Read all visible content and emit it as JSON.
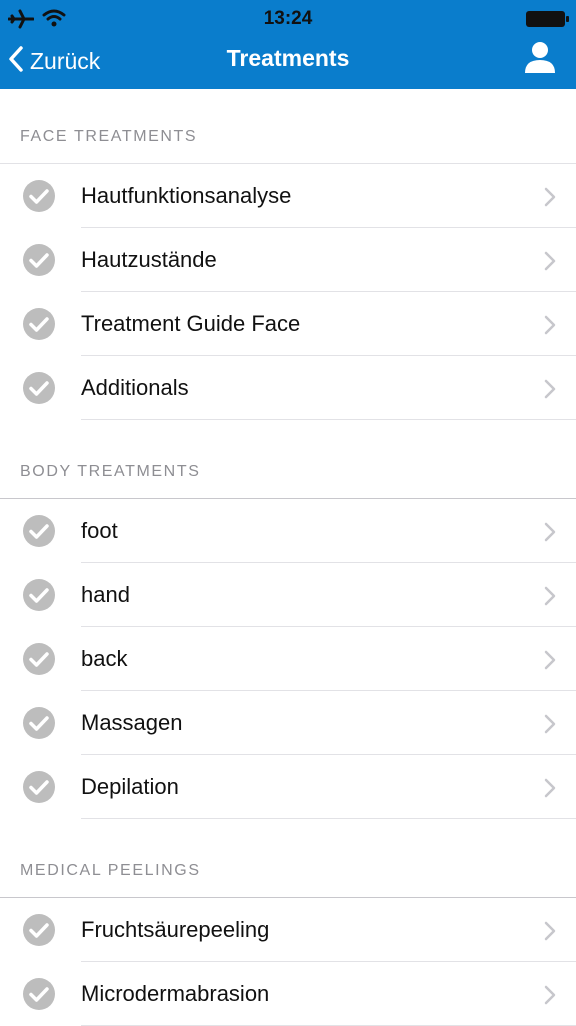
{
  "status_bar": {
    "time": "13:24"
  },
  "nav": {
    "back_label": "Zurück",
    "title": "Treatments"
  },
  "colors": {
    "header_background": "#0a7dcc",
    "check_icon": "#bdbdbd",
    "chevron": "#c7c7cc",
    "section_header_text": "#8e8e93"
  },
  "icons": {
    "status": [
      "airplane-icon",
      "wifi-icon",
      "battery-icon"
    ],
    "nav": [
      "chevron-left-icon",
      "user-icon"
    ],
    "row": [
      "checkmark-circle-icon",
      "chevron-right-icon"
    ]
  },
  "sections": [
    {
      "title": "FACE TREATMENTS",
      "items": [
        {
          "label": "Hautfunktionsanalyse"
        },
        {
          "label": "Hautzustände"
        },
        {
          "label": "Treatment Guide Face"
        },
        {
          "label": "Additionals"
        }
      ]
    },
    {
      "title": "BODY TREATMENTS",
      "items": [
        {
          "label": "foot"
        },
        {
          "label": "hand"
        },
        {
          "label": "back"
        },
        {
          "label": "Massagen"
        },
        {
          "label": "Depilation"
        }
      ]
    },
    {
      "title": "MEDICAL PEELINGS",
      "items": [
        {
          "label": "Fruchtsäurepeeling"
        },
        {
          "label": "Microdermabrasion"
        }
      ]
    }
  ]
}
